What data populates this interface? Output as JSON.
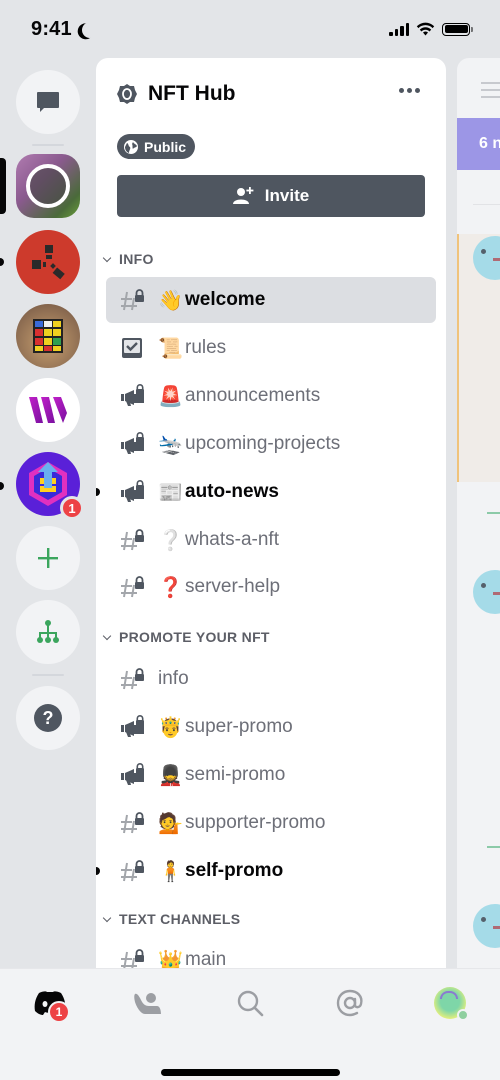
{
  "status_bar": {
    "time": "9:41",
    "signal_bars": 4,
    "battery_percent": 100
  },
  "guild_rail": {
    "direct_messages_label": "Direct Messages",
    "servers": [
      {
        "name": "Profile Server",
        "selected": true,
        "unread": false,
        "mentions": 0
      },
      {
        "name": "Rust",
        "selected": false,
        "unread": true,
        "mentions": 0
      },
      {
        "name": "Rubik's Cube",
        "selected": false,
        "unread": false,
        "mentions": 0
      },
      {
        "name": "W Server",
        "selected": false,
        "unread": false,
        "mentions": 0
      },
      {
        "name": "NFT Hub",
        "selected": false,
        "unread": true,
        "mentions": 1
      }
    ],
    "add_server_label": "Add a Server",
    "discover_label": "Explore Public Servers",
    "help_label": "Help",
    "mention_badge": "1"
  },
  "server": {
    "name": "NFT Hub",
    "badge": "Public",
    "invite_label": "Invite",
    "categories": [
      {
        "name": "INFO",
        "channels": [
          {
            "type": "text-locked",
            "emoji": "👋",
            "name": "welcome",
            "selected": true,
            "unread": false
          },
          {
            "type": "rules",
            "emoji": "📜",
            "name": "rules",
            "selected": false,
            "unread": false
          },
          {
            "type": "announcement-locked",
            "emoji": "🚨",
            "name": "announcements",
            "selected": false,
            "unread": false
          },
          {
            "type": "announcement-locked",
            "emoji": "🛬",
            "name": "upcoming-projects",
            "selected": false,
            "unread": false
          },
          {
            "type": "announcement-locked",
            "emoji": "📰",
            "name": "auto-news",
            "selected": false,
            "unread": true
          },
          {
            "type": "text-locked",
            "emoji": "❔",
            "name": "whats-a-nft",
            "selected": false,
            "unread": false
          },
          {
            "type": "text-locked",
            "emoji": "❓",
            "name": "server-help",
            "selected": false,
            "unread": false
          }
        ]
      },
      {
        "name": "PROMOTE YOUR NFT",
        "channels": [
          {
            "type": "text-locked",
            "emoji": "",
            "name": "info",
            "selected": false,
            "unread": false
          },
          {
            "type": "announcement-locked",
            "emoji": "🤴",
            "name": "super-promo",
            "selected": false,
            "unread": false
          },
          {
            "type": "announcement-locked",
            "emoji": "💂",
            "name": "semi-promo",
            "selected": false,
            "unread": false
          },
          {
            "type": "text-locked",
            "emoji": "💁",
            "name": "supporter-promo",
            "selected": false,
            "unread": false
          },
          {
            "type": "text-locked",
            "emoji": "🧍",
            "name": "self-promo",
            "selected": false,
            "unread": true
          }
        ]
      },
      {
        "name": "TEXT CHANNELS",
        "channels": [
          {
            "type": "text-locked",
            "emoji": "👑",
            "name": "main",
            "selected": false,
            "unread": false
          }
        ]
      }
    ]
  },
  "peek_panel": {
    "banner_text": "6 n"
  },
  "bottom_nav": {
    "items": [
      {
        "name": "home",
        "label": "Home",
        "badge": "1"
      },
      {
        "name": "friends",
        "label": "Friends"
      },
      {
        "name": "search",
        "label": "Search"
      },
      {
        "name": "mentions",
        "label": "Mentions"
      },
      {
        "name": "profile",
        "label": "You"
      }
    ]
  },
  "colors": {
    "accent_red": "#ed4245",
    "green": "#3ba55d",
    "blurple_banner": "#9c96e6",
    "dark_button": "#4f5660"
  }
}
